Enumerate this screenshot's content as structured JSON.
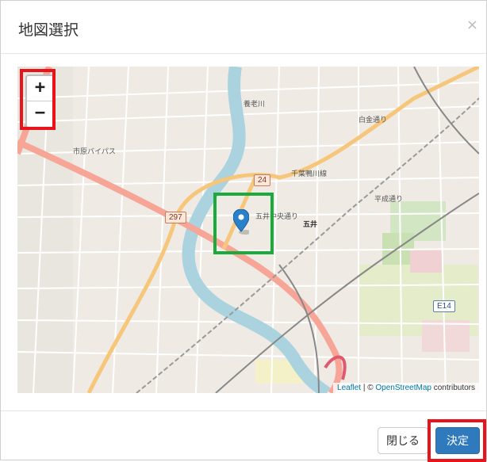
{
  "modal": {
    "title": "地図選択",
    "close_symbol": "×"
  },
  "map": {
    "zoom_in": "+",
    "zoom_out": "−",
    "attribution_leaflet": "Leaflet",
    "attribution_sep": " | © ",
    "attribution_osm": "OpenStreetMap",
    "attribution_contrib": " contributors",
    "labels": {
      "route_297": "297",
      "route_24": "24",
      "route_e14": "E14",
      "station_goi": "五井",
      "road_chiba_kamogawa": "千葉鴨川線",
      "road_goi_chuo": "五井中央通り",
      "road_bypass": "市原バイパス",
      "road_shirokane": "白金通り",
      "road_heisei": "平成通り",
      "river_yoro": "養老川"
    },
    "marker_icon": "map-marker",
    "highlight_colors": {
      "zoom_controls": "#e8131b",
      "marker": "#1aab3c",
      "confirm_button": "#e8131b"
    }
  },
  "footer": {
    "close_label": "閉じる",
    "confirm_label": "決定"
  }
}
